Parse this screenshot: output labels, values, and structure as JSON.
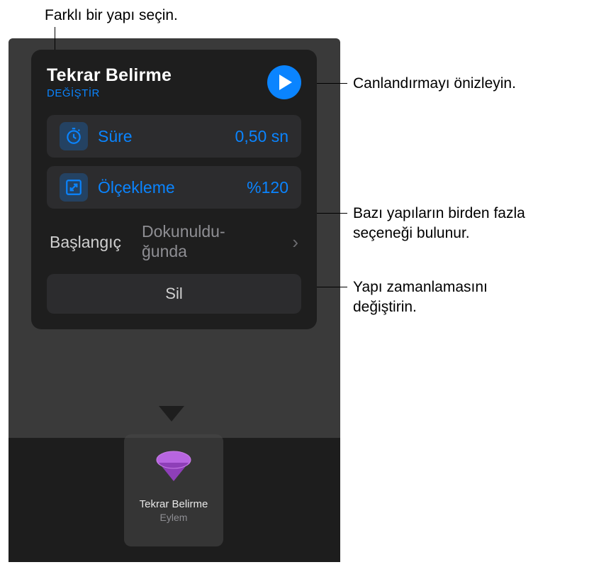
{
  "callouts": {
    "top": "Farklı bir yapı seçin.",
    "preview": "Canlandırmayı önizleyin.",
    "options": "Bazı yapıların birden fazla seçeneği bulunur.",
    "timing": "Yapı zamanlamasını değiştirin."
  },
  "popover": {
    "title": "Tekrar Belirme",
    "change": "DEĞİŞTİR",
    "duration": {
      "label": "Süre",
      "value": "0,50 sn"
    },
    "scale": {
      "label": "Ölçekleme",
      "value": "%120"
    },
    "start": {
      "label": "Başlangıç",
      "value": "Dokunuldu-\nğunda"
    },
    "delete": "Sil"
  },
  "thumbnail": {
    "title": "Tekrar Belirme",
    "subtitle": "Eylem"
  }
}
